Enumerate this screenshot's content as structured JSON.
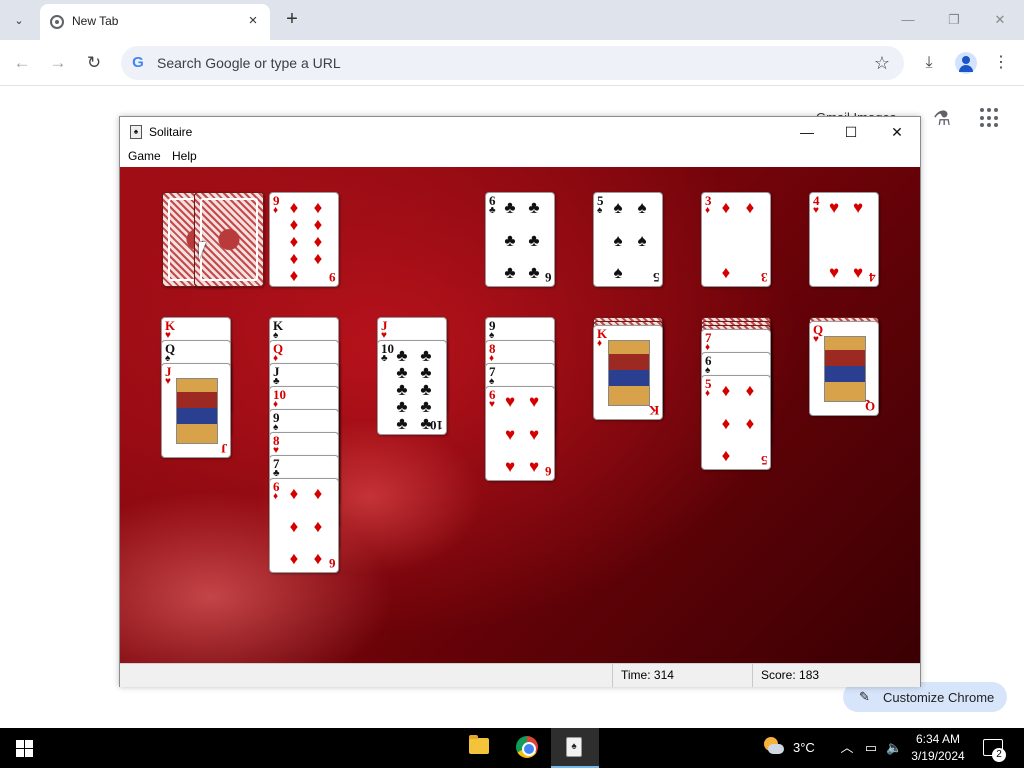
{
  "browser": {
    "tab_title": "New Tab",
    "omnibox_placeholder": "Search Google or type a URL",
    "ntp_links": "Gmail Images",
    "customize_label": "Customize Chrome"
  },
  "solitaire": {
    "title": "Solitaire",
    "menu": [
      "Game",
      "Help"
    ],
    "status": {
      "time_label": "Time:",
      "time_value": "314",
      "score_label": "Score:",
      "score_value": "183"
    },
    "stock": {
      "label": "stock",
      "cards": "face-down"
    },
    "waste": [
      {
        "rank": "9",
        "suit": "♦",
        "color": "red"
      }
    ],
    "foundations": [
      {
        "rank": "6",
        "suit": "♣",
        "color": "black"
      },
      {
        "rank": "5",
        "suit": "♠",
        "color": "black"
      },
      {
        "rank": "3",
        "suit": "♦",
        "color": "red"
      },
      {
        "rank": "4",
        "suit": "♥",
        "color": "red"
      }
    ],
    "tableau": [
      {
        "hidden": 0,
        "cards": [
          {
            "rank": "K",
            "suit": "♥",
            "color": "red"
          },
          {
            "rank": "Q",
            "suit": "♠",
            "color": "black"
          },
          {
            "rank": "J",
            "suit": "♥",
            "color": "red"
          }
        ]
      },
      {
        "hidden": 0,
        "cards": [
          {
            "rank": "K",
            "suit": "♠",
            "color": "black"
          },
          {
            "rank": "Q",
            "suit": "♦",
            "color": "red"
          },
          {
            "rank": "J",
            "suit": "♣",
            "color": "black"
          },
          {
            "rank": "10",
            "suit": "♦",
            "color": "red"
          },
          {
            "rank": "9",
            "suit": "♠",
            "color": "black"
          },
          {
            "rank": "8",
            "suit": "♥",
            "color": "red"
          },
          {
            "rank": "7",
            "suit": "♣",
            "color": "black"
          },
          {
            "rank": "6",
            "suit": "♦",
            "color": "red"
          }
        ]
      },
      {
        "hidden": 0,
        "cards": [
          {
            "rank": "J",
            "suit": "♥",
            "color": "red"
          },
          {
            "rank": "10",
            "suit": "♣",
            "color": "black"
          }
        ]
      },
      {
        "hidden": 0,
        "cards": [
          {
            "rank": "9",
            "suit": "♠",
            "color": "black"
          },
          {
            "rank": "8",
            "suit": "♦",
            "color": "red"
          },
          {
            "rank": "7",
            "suit": "♠",
            "color": "black"
          },
          {
            "rank": "6",
            "suit": "♥",
            "color": "red"
          }
        ]
      },
      {
        "hidden": 2,
        "cards": [
          {
            "rank": "K",
            "suit": "♦",
            "color": "red"
          }
        ]
      },
      {
        "hidden": 3,
        "cards": [
          {
            "rank": "7",
            "suit": "♦",
            "color": "red"
          },
          {
            "rank": "6",
            "suit": "♠",
            "color": "black"
          },
          {
            "rank": "5",
            "suit": "♦",
            "color": "red"
          }
        ]
      },
      {
        "hidden": 1,
        "cards": [
          {
            "rank": "Q",
            "suit": "♥",
            "color": "red"
          }
        ]
      }
    ]
  },
  "taskbar": {
    "temperature": "3°C",
    "time": "6:34 AM",
    "date": "3/19/2024",
    "notifications": "2"
  },
  "colors": {
    "felt": "#9d0c14",
    "accent": "#76b9ed"
  }
}
